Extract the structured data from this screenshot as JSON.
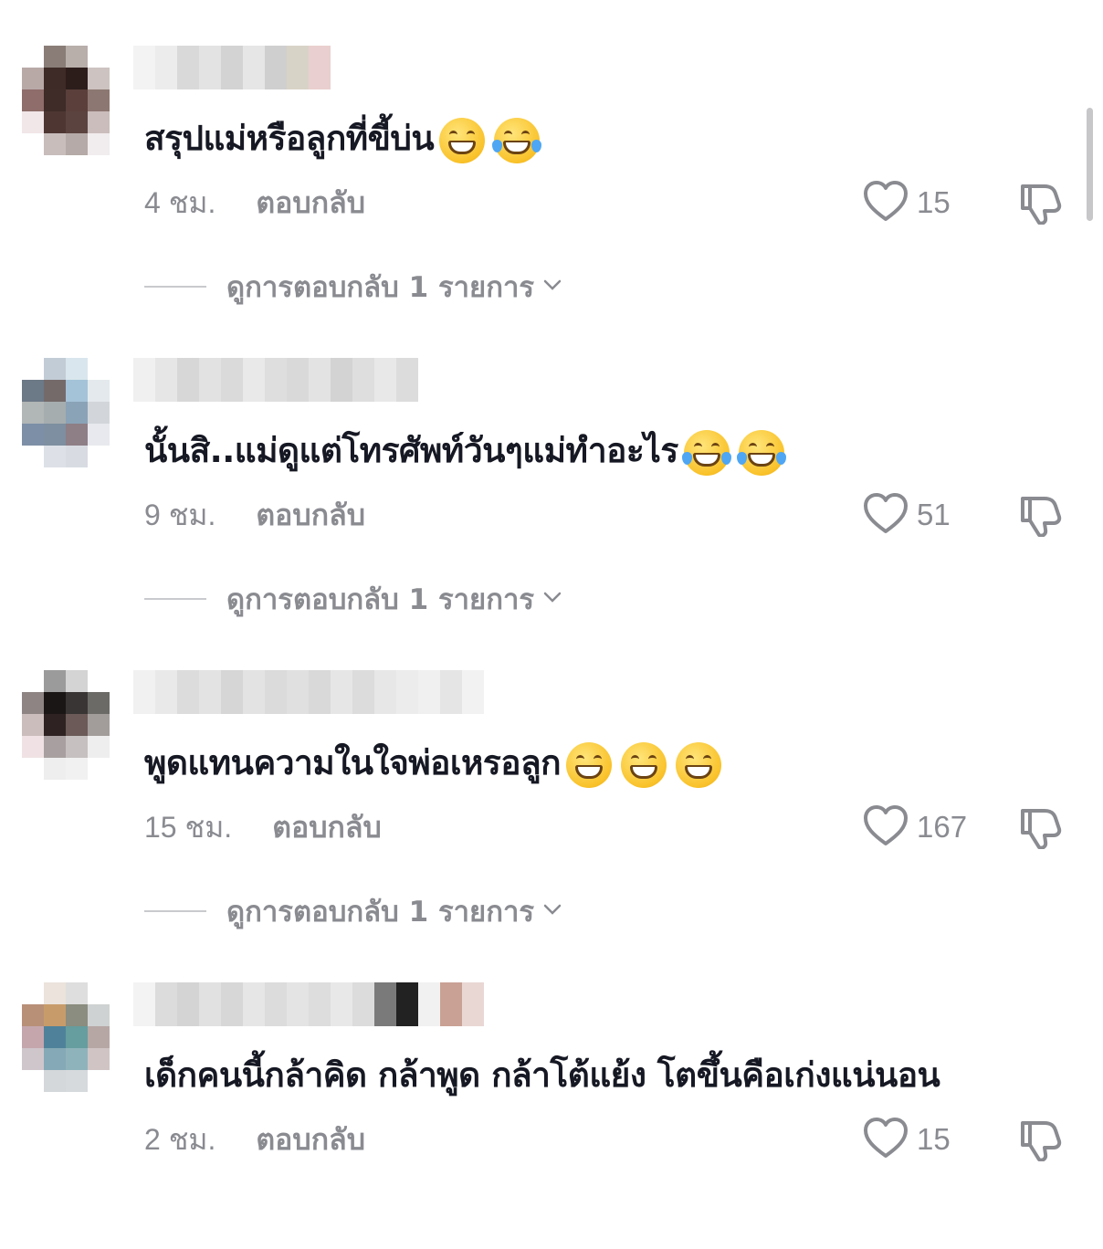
{
  "reply_label": "ตอบกลับ",
  "comments": [
    {
      "text": "สรุปแม่หรือลูกที่ขี้บ่น",
      "emojis": [
        "grinning-face",
        "tears-of-joy"
      ],
      "time": "4 ชม.",
      "likes": "15",
      "view_replies": "ดูการตอบกลับ 1 รายการ",
      "avatar_colors": [
        "#ffffff",
        "#8a7d78",
        "#b8aeaa",
        "#ffffff",
        "#b8a9a7",
        "#3e2a27",
        "#2c1d1b",
        "#cdc3c1",
        "#8e6d6a",
        "#3f2b28",
        "#5a3f3a",
        "#8d7772",
        "#f1e6e8",
        "#4e3733",
        "#5b433f",
        "#cabdbb",
        "#ffffff",
        "#c8bdbb",
        "#b5aaa7",
        "#f1eced"
      ],
      "username_colors": [
        "#f3f3f3",
        "#ececec",
        "#d9d9d9",
        "#e3e3e3",
        "#d3d3d3",
        "#e6e6e6",
        "#cfcfcf",
        "#d8d3c7",
        "#e9cfcf"
      ]
    },
    {
      "text": "นั้นสิ..แม่ดูแต่โทรศัพท์วันๆแม่ทำอะไร",
      "emojis": [
        "tears-of-joy",
        "tears-of-joy"
      ],
      "time": "9 ชม.",
      "likes": "51",
      "view_replies": "ดูการตอบกลับ 1 รายการ",
      "avatar_colors": [
        "#ffffff",
        "#c2ccd6",
        "#d9e6ed",
        "#ffffff",
        "#6c7987",
        "#756a6a",
        "#a4c3d8",
        "#e4e9ee",
        "#b1b6b6",
        "#a6adae",
        "#8aa3b7",
        "#d2d6db",
        "#7d8fa6",
        "#7d8fa0",
        "#8e7e86",
        "#e8e9ee",
        "#ffffff",
        "#dde1e7",
        "#d8dbe2",
        "#ffffff"
      ],
      "username_colors": [
        "#f0f0f0",
        "#e6e6e6",
        "#d7d7d7",
        "#e2e2e2",
        "#dadada",
        "#e9e9e9",
        "#dedede",
        "#d9d9d9",
        "#e3e3e3",
        "#d3d3d3",
        "#dedede",
        "#e8e8e8",
        "#dcdcdc"
      ]
    },
    {
      "text": "พูดแทนความในใจพ่อเหรอลูก",
      "emojis": [
        "grinning-face",
        "grinning-face",
        "grinning-face"
      ],
      "time": "15 ชม.",
      "likes": "167",
      "view_replies": "ดูการตอบกลับ 1 รายการ",
      "avatar_colors": [
        "#ffffff",
        "#9b9b9b",
        "#d4d4d4",
        "#ffffff",
        "#8e8484",
        "#1b1616",
        "#3a3535",
        "#6b6a67",
        "#cbbdbb",
        "#2e2222",
        "#6b5a57",
        "#a29d9a",
        "#f0e2e4",
        "#a8a0a0",
        "#c6c0c0",
        "#eeeeee",
        "#ffffff",
        "#eeeeee",
        "#f1f1f1",
        "#ffffff"
      ],
      "username_colors": [
        "#f1f1f1",
        "#e9e9e9",
        "#dcdcdc",
        "#e3e3e3",
        "#d6d6d6",
        "#e3e3e3",
        "#dbdbdb",
        "#e0e0e0",
        "#d9d9d9",
        "#e6e6e6",
        "#dcdcdc",
        "#e7e7e7",
        "#ececec",
        "#f0f0f0",
        "#e5e5e5",
        "#f2f2f2"
      ]
    },
    {
      "text": "เด็กคนนี้กล้าคิด กล้าพูด กล้าโต้แย้ง โตขึ้นคือเก่งแน่นอน",
      "emojis": [],
      "time": "2 ชม.",
      "likes": "15",
      "view_replies": "",
      "avatar_colors": [
        "#ffffff",
        "#ebe3dc",
        "#dedede",
        "#ffffff",
        "#b89078",
        "#c79c6a",
        "#8a8d7f",
        "#cfd2d2",
        "#c5a6ad",
        "#4f829a",
        "#669d9e",
        "#b6a7a5",
        "#cfc6cb",
        "#85a9b6",
        "#8fb3ba",
        "#d0c4c5",
        "#ffffff",
        "#d4d8da",
        "#d6dadc",
        "#ffffff"
      ],
      "username_colors": [
        "#f3f3f3",
        "#dcdcdc",
        "#d4d4d4",
        "#e1e1e1",
        "#d7d7d7",
        "#e6e6e6",
        "#dcdcdc",
        "#e4e4e4",
        "#dddddd",
        "#e8e8e8",
        "#dcdcdc",
        "#7a7a7a",
        "#222222",
        "#f1f1f1",
        "#c9a195",
        "#e9d7d3"
      ]
    }
  ]
}
